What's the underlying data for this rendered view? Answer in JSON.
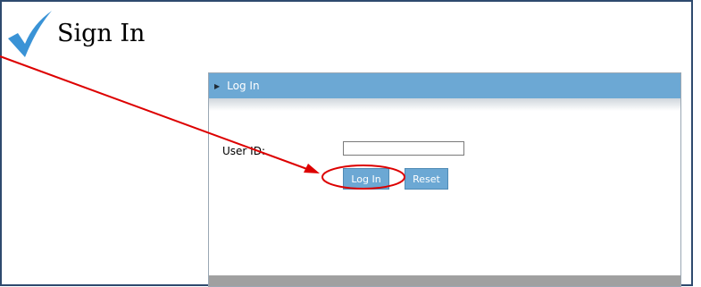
{
  "page": {
    "title": "Sign In"
  },
  "panel": {
    "title": "Log In"
  },
  "form": {
    "user_id_label": "User ID:",
    "user_id_value": "",
    "login_label": "Log In",
    "reset_label": "Reset"
  },
  "colors": {
    "accent": "#6ca8d4",
    "annotation": "#dd0000",
    "check": "#3a93d6"
  }
}
